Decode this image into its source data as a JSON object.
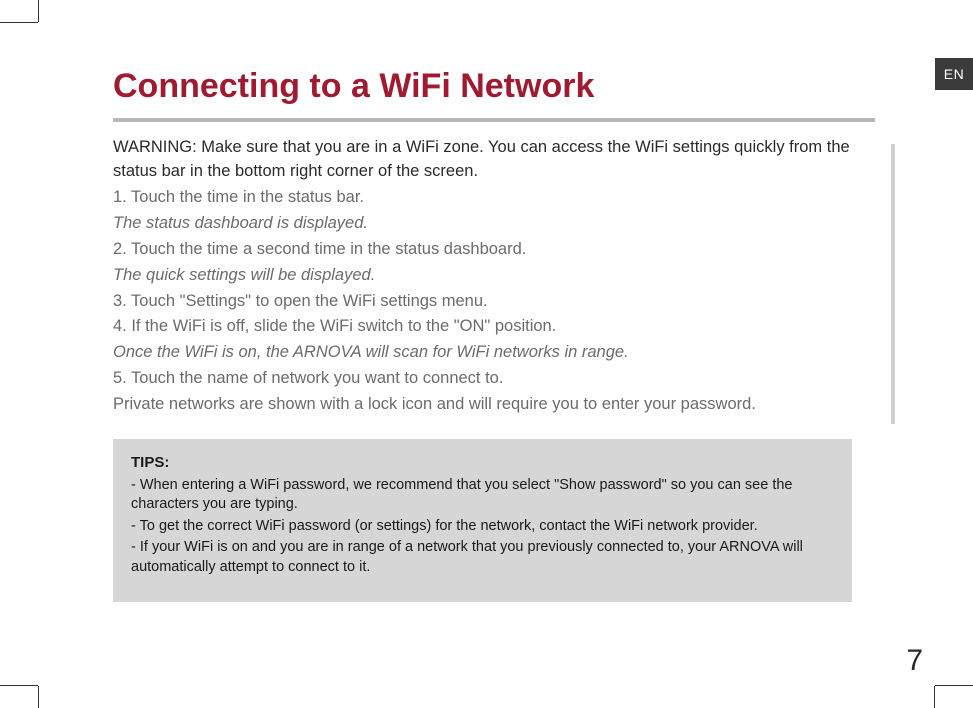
{
  "lang_tag": "EN",
  "title": "Connecting to a WiFi Network",
  "warning": "WARNING:  Make sure that you are in a WiFi zone. You can access the WiFi settings quickly from the status bar in the bottom right corner of the screen.",
  "steps": {
    "s1": "1. Touch the time in the status bar.",
    "s1_note": "The status dashboard is displayed.",
    "s2": "2. Touch the time a second time in the status dashboard.",
    "s2_note": "The quick settings will be displayed.",
    "s3": "3. Touch \"Settings\" to open the WiFi settings menu.",
    "s4": "4. If the WiFi is off, slide the WiFi switch to the \"ON\" position.",
    "s4_note": "Once the WiFi is on, the ARNOVA will scan for WiFi networks in range.",
    "s5": "5. Touch the name of network you want to connect to.",
    "s5_note": "Private networks are shown with a lock icon and will require you to enter your password."
  },
  "tips": {
    "label": "TIPS:",
    "t1": "-   When entering a WiFi password, we recommend that you select \"Show password\" so you can see the characters you are typing.",
    "t2": "-   To get the correct WiFi password (or settings) for the network, contact the WiFi network provider.",
    "t3": "-   If your WiFi is on and you are in range of a network that you previously connected to, your ARNOVA will automatically attempt to connect to it."
  },
  "page_number": "7"
}
